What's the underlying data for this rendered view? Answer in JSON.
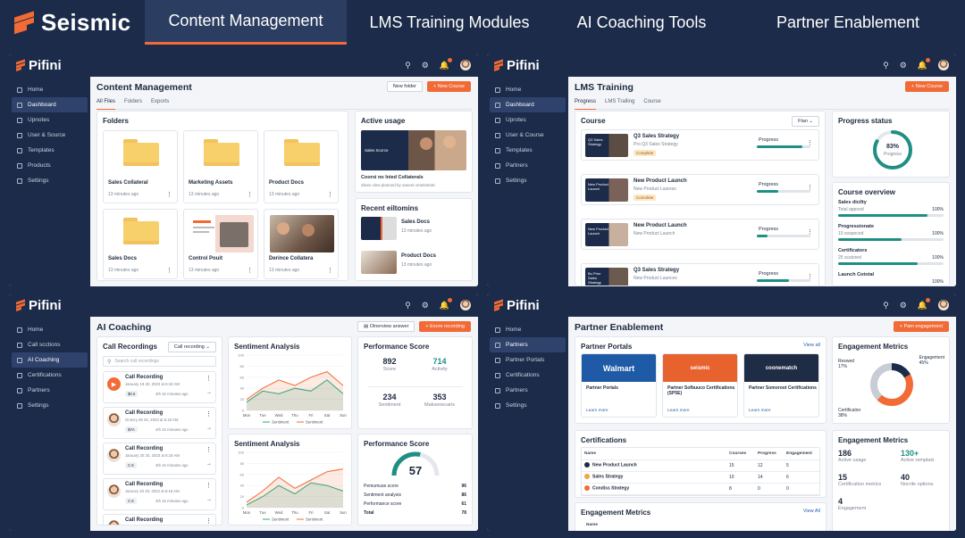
{
  "topnav": {
    "brand": "Seismic",
    "tabs": [
      "Content Management",
      "LMS Training Modules",
      "AI Coaching Tools",
      "Partner Enablement"
    ]
  },
  "app_name": "Pifini",
  "colors": {
    "navy": "#1b2b49",
    "accent": "#f26a35",
    "teal": "#1f8f84"
  },
  "header_icons": [
    "search-icon",
    "gear-icon",
    "bell-icon",
    "avatar"
  ],
  "panel1": {
    "nav": [
      "Home",
      "Dashboard",
      "Upnotes",
      "User & Source",
      "Templates",
      "Products",
      "Settings"
    ],
    "title": "Content Management",
    "btn_new_folder": "New folder",
    "btn_new_course": "+ New Course",
    "tabs": [
      "All Files",
      "Folders",
      "Exports"
    ],
    "folders_title": "Folders",
    "folders": [
      {
        "name": "Sales Collateral",
        "meta": "13 minutes ago"
      },
      {
        "name": "Marketing Assets",
        "meta": "13 minutes ago"
      },
      {
        "name": "Product Docs",
        "meta": "13 minutes ago"
      },
      {
        "name": "Sales Docs",
        "meta": "13 minutes ago"
      },
      {
        "name": "Control Pouit",
        "meta": "13 minutes ago"
      },
      {
        "name": "Derince Collatera",
        "meta": "13 minutes ago"
      }
    ],
    "active_usage_title": "Active usage",
    "active_thumb_text": "Sales Scorce",
    "active_caption": "Coorsi no Inied Collaterals",
    "active_sub": "Slees view planned by sanest ometestset.",
    "recent_title": "Recent eiltomins",
    "recent": [
      {
        "name": "Sales Docs",
        "meta": "13 minutes ago"
      },
      {
        "name": "Product Docs",
        "meta": "13 minutes ago"
      }
    ]
  },
  "panel2": {
    "nav": [
      "Home",
      "Dashboard",
      "Uprotes",
      "User & Course",
      "Templates",
      "Partners",
      "Settings"
    ],
    "title": "LMS Training",
    "btn_new_course": "+ New Course",
    "tabs": [
      "Progress",
      "LMS Tralling",
      "Course"
    ],
    "course_title": "Course",
    "plan_label": "Flan",
    "courses": [
      {
        "thumb": "Q3 Sales Strategy",
        "name": "Q3 Sales Strategy",
        "sub": "Pro Q3 Sales Strategy",
        "badge": "Complete",
        "progress_label": "Progress",
        "progress": 0.85
      },
      {
        "thumb": "New Product Launch",
        "name": "New Product Launch",
        "sub": "New Product Lauress",
        "badge": "Comolete",
        "progress_label": "Progress",
        "progress": 0.4
      },
      {
        "thumb": "New Product Launch",
        "name": "New Product Launch",
        "sub": "New Product Launch",
        "badge": "",
        "progress_label": "Progress",
        "progress": 0.2
      },
      {
        "thumb": "Bu Prior Sales Strategy",
        "name": "Q3 Sales Strategy",
        "sub": "New Product Launces",
        "badge": "",
        "progress_label": "Progress",
        "progress": 0.6
      }
    ],
    "progress_status_title": "Progress status",
    "donut_value": "83%",
    "donut_label": "Progress",
    "donut_pct": 0.83,
    "overview_title": "Course overview",
    "overview": [
      {
        "label": "Sales dicilty",
        "sub": "Total appood",
        "pct": "100%",
        "value": 0.85
      },
      {
        "label": "Progressionate",
        "sub": "10 sospeced",
        "pct": "100%",
        "value": 0.6
      },
      {
        "label": "Certificators",
        "sub": "25 scalored",
        "pct": "100%",
        "value": 0.75
      },
      {
        "label": "Launch Cototal",
        "sub": "",
        "pct": "100%",
        "value": 0.4
      }
    ]
  },
  "panel3": {
    "nav": [
      "Home",
      "Call scctions",
      "AI Coaching",
      "Certifications",
      "Partners",
      "Settings"
    ],
    "title": "AI Coaching",
    "btn_overview": "Oinerview answer",
    "btn_record": "+ Exore recording",
    "calls_title": "Call Recordings",
    "calls_filter": "Call recording",
    "search_placeholder": "Search call recordings",
    "calls": [
      {
        "name": "Call Recording",
        "date": "January 19 20, 2023 at 6:18 AM",
        "tag": "$0.6",
        "meta": "4th 16 minutes ago"
      },
      {
        "name": "Call Recording",
        "date": "Gnovry 29 20, 2023 at 6:18 AM",
        "tag": "$YA",
        "meta": "4th 16 minutes ago"
      },
      {
        "name": "Call Recording",
        "date": "January 20 20, 2023 at 8:18 AM",
        "tag": "C.6",
        "meta": "4th 16 minutes ago"
      },
      {
        "name": "Call Recording",
        "date": "Janusry 20 20, 2023 at 6:18 AM",
        "tag": "C.6",
        "meta": "4th 16 minutes ago"
      },
      {
        "name": "Call Recording",
        "date": "",
        "tag": "",
        "meta": ""
      }
    ],
    "sentiment_top": {
      "title": "Sentiment Analysis",
      "legend": [
        "Sentiment",
        "Sentiment"
      ],
      "days": [
        "Mon",
        "Tue",
        "Wed",
        "Thu",
        "Fri",
        "Sat",
        "Sun"
      ],
      "y_ticks": [
        "100",
        "80",
        "60",
        "40",
        "20",
        "0"
      ],
      "red": [
        20,
        40,
        55,
        45,
        60,
        70,
        45
      ],
      "green": [
        15,
        35,
        30,
        40,
        35,
        55,
        30
      ]
    },
    "perf_top": {
      "title": "Performance Score",
      "metrics": [
        {
          "value": "892",
          "label": "Score"
        },
        {
          "value": "714",
          "label": "Activity"
        },
        {
          "value": "234",
          "label": "Sentiment"
        },
        {
          "value": "353",
          "label": "Maksenecaris"
        }
      ]
    },
    "sentiment_bottom": {
      "title": "Sentiment Analysis",
      "legend": [
        "Sentiment",
        "Sentiment"
      ],
      "days": [
        "Mon",
        "Tue",
        "Wed",
        "Thu",
        "Fri",
        "Sat",
        "Sun"
      ],
      "y_ticks": [
        "100",
        "80",
        "60",
        "40",
        "20",
        "0"
      ],
      "red": [
        10,
        30,
        55,
        35,
        50,
        65,
        70
      ],
      "green": [
        5,
        20,
        40,
        25,
        45,
        40,
        30
      ]
    },
    "perf_bottom": {
      "title": "Performance Score",
      "gauge": "57",
      "gauge_value": 0.57,
      "rows": [
        {
          "label": "Pemumuse score",
          "value": "96"
        },
        {
          "label": "Sentiment analysis",
          "value": "86"
        },
        {
          "label": "Performance score",
          "value": "61"
        },
        {
          "label": "Total",
          "value": "78"
        }
      ]
    }
  },
  "panel4": {
    "nav": [
      "Home",
      "Partners",
      "Partner Portals",
      "Certifications",
      "Partners",
      "Settings"
    ],
    "title": "Partner Enablement",
    "btn_new": "+ Pam engagement",
    "portals_title": "Partner Portals",
    "view_all": "View all",
    "portals": [
      {
        "brand": "Walmart",
        "name": "Partner Portals",
        "link": "Learn more",
        "color": "#1f5aa6"
      },
      {
        "brand": "seismic",
        "name": "Partner Sofbuuco Certifications (SP5E)",
        "link": "Learn more",
        "color": "#e8622e"
      },
      {
        "brand": "coonematch",
        "name": "Partner Somoroot Certifications",
        "link": "Learn more",
        "color": "#1f2c45"
      }
    ],
    "cert_title": "Certifications",
    "cert_headers": [
      "Name",
      "Courses",
      "Progress",
      "Engagement"
    ],
    "cert_rows": [
      {
        "name": "New Product Launch",
        "courses": "15",
        "progress": "12",
        "engagement": "5"
      },
      {
        "name": "Sales Strategy",
        "courses": "10",
        "progress": "14",
        "engagement": "6"
      },
      {
        "name": "Condiss Strategy",
        "courses": "8",
        "progress": "0",
        "engagement": "0"
      }
    ],
    "eng_bottom_title": "Engagement Metrics",
    "eng_bottom_link": "View All",
    "eng_bottom_header": "Name",
    "eng_donut_title": "Engagement Metrics",
    "donut_labels": [
      {
        "label": "Reswed",
        "pct": "17%"
      },
      {
        "label": "Engagement",
        "pct": "45%"
      },
      {
        "label": "Certificatior",
        "pct": "38%"
      }
    ],
    "donut_values": [
      0.17,
      0.45,
      0.38
    ],
    "eng_stats_title": "Engagement Metrics",
    "stats": [
      {
        "value": "186",
        "label": "Active usage"
      },
      {
        "value": "130+",
        "label": "Active remplats"
      },
      {
        "value": "15",
        "label": "Certification metrics"
      },
      {
        "value": "40",
        "label": "Nocrile options"
      },
      {
        "value": "4",
        "label": "Engagement"
      }
    ]
  }
}
